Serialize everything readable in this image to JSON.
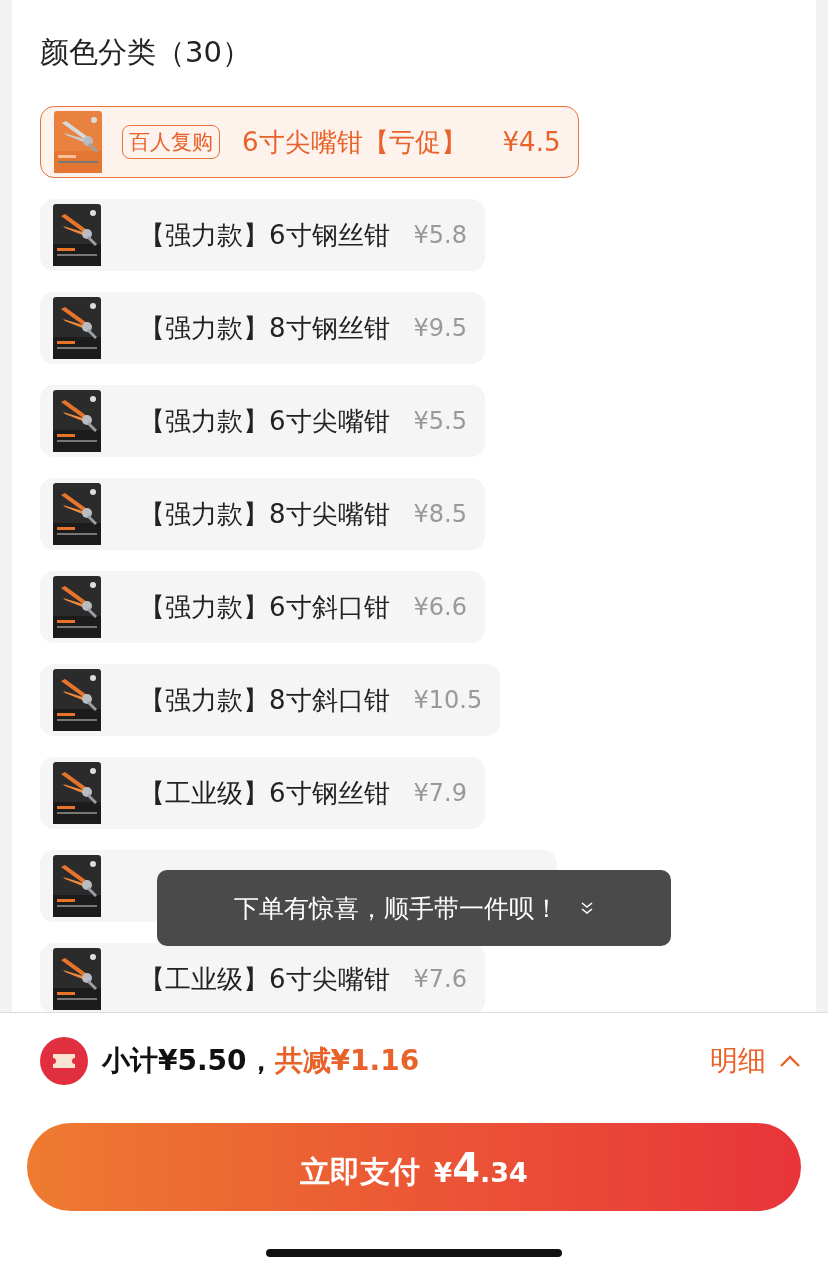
{
  "section_title": "颜色分类（30）",
  "options": [
    {
      "badge": "百人复购",
      "name": "6寸尖嘴钳【亏促】",
      "price": "¥4.5",
      "selected": true
    },
    {
      "name": "【强力款】6寸钢丝钳",
      "price": "¥5.8",
      "selected": false
    },
    {
      "name": "【强力款】8寸钢丝钳",
      "price": "¥9.5",
      "selected": false
    },
    {
      "name": "【强力款】6寸尖嘴钳",
      "price": "¥5.5",
      "selected": false
    },
    {
      "name": "【强力款】8寸尖嘴钳",
      "price": "¥8.5",
      "selected": false
    },
    {
      "name": "【强力款】6寸斜口钳",
      "price": "¥6.6",
      "selected": false
    },
    {
      "name": "【强力款】8寸斜口钳",
      "price": "¥10.5",
      "selected": false
    },
    {
      "name": "【工业级】6寸钢丝钳",
      "price": "¥7.9",
      "selected": false
    },
    {
      "selected": false
    },
    {
      "name": "【工业级】6寸尖嘴钳",
      "price": "¥7.6",
      "selected": false
    }
  ],
  "toast": "下单有惊喜，顺手带一件呗！",
  "summary": {
    "subtotal": "小计¥5.50，",
    "discount": "共减¥1.16",
    "details_link": "明细"
  },
  "pay_button": {
    "label": "立即支付",
    "currency": "¥",
    "amount_main": "4",
    "amount_decimal": ".34"
  }
}
